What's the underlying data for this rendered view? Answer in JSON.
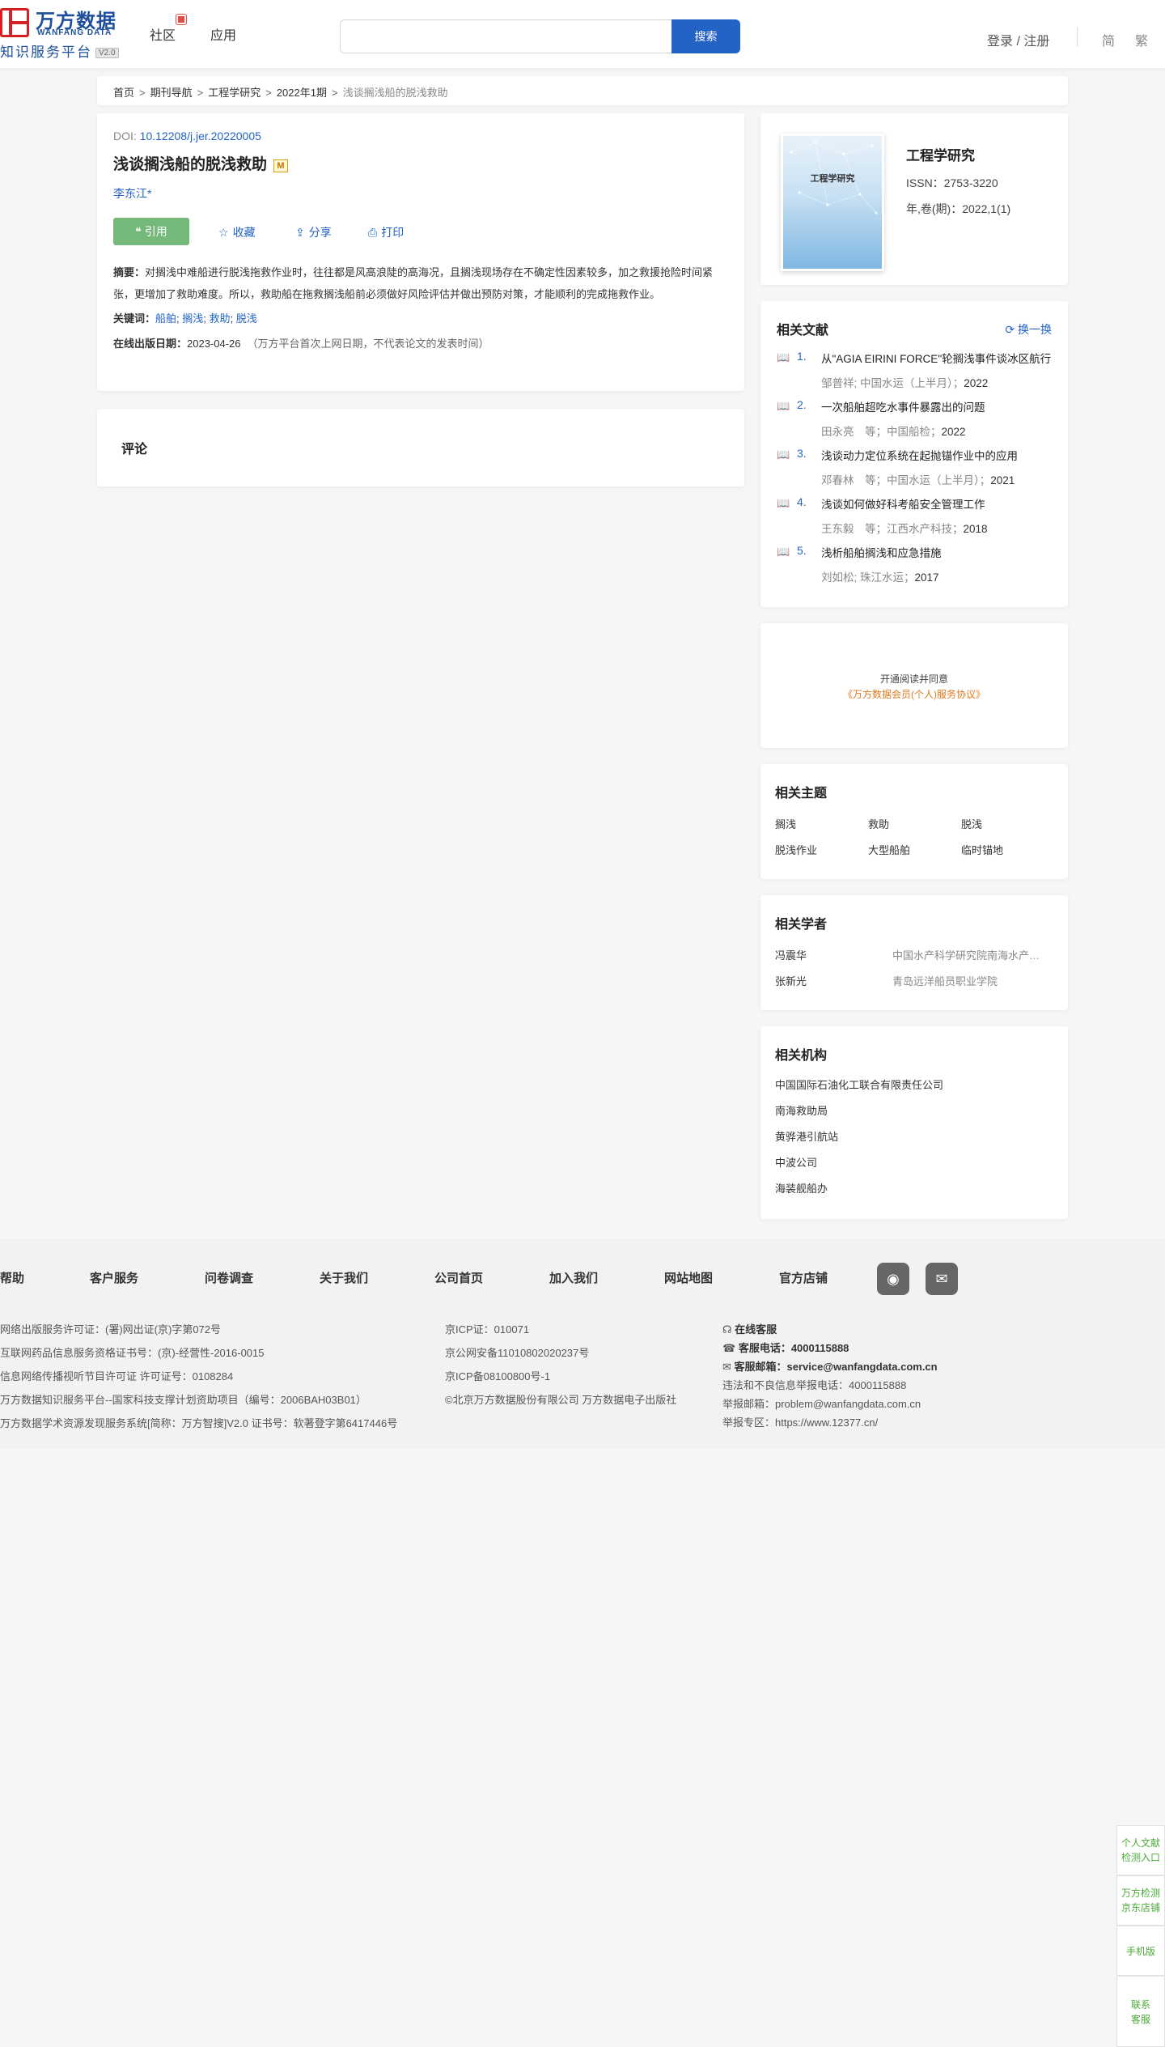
{
  "header": {
    "logo": {
      "cn": "万方数据",
      "en": "WANFANG DATA",
      "sub": "知识服务平台",
      "ver": "V2.0"
    },
    "nav": {
      "community": "社区",
      "apps": "应用"
    },
    "search": {
      "placeholder": "",
      "button": "搜索"
    },
    "login": "登录 / 注册",
    "lang_simp": "简",
    "lang_trad": "繁"
  },
  "breadcrumb": {
    "items": [
      "首页",
      "期刊导航",
      "工程学研究",
      "2022年1期"
    ],
    "current": "浅谈搁浅船的脱浅救助",
    "sep": ">"
  },
  "article": {
    "doi_label": "DOI: ",
    "doi": "10.12208/j.jer.20220005",
    "title": "浅谈搁浅船的脱浅救助",
    "badge": "M",
    "author": "李东江*",
    "actions": {
      "cite": "引用",
      "favorite": "收藏",
      "share": "分享",
      "print": "打印"
    },
    "abstract_label": "摘要：",
    "abstract": "对搁浅中难船进行脱浅拖救作业时，往往都是风高浪陡的高海况，且搁浅现场存在不确定性因素较多，加之救援抢险时间紧张，更增加了救助难度。所以，救助船在拖救搁浅船前必须做好风险评估并做出预防对策，才能顺利的完成拖救作业。",
    "keywords_label": "关键词：",
    "keywords": [
      "船舶",
      "搁浅",
      "救助",
      "脱浅"
    ],
    "pubdate_label": "在线出版日期：",
    "pubdate": "2023-04-26",
    "pubdate_note": "（万方平台首次上网日期，不代表论文的发表时间）"
  },
  "comments": {
    "title": "评论"
  },
  "journal": {
    "cover_title": "工程学研究",
    "name": "工程学研究",
    "issn": "ISSN：2753-3220",
    "volume": "年,卷(期)：2022,1(1)"
  },
  "related_literature": {
    "title": "相关文献",
    "refresh": "换一换",
    "items": [
      {
        "num": "1.",
        "title": "从\"AGIA EIRINI FORCE\"轮搁浅事件谈冰区航行",
        "authors": "邹普祥; 中国水运（上半月）；",
        "year": "2022"
      },
      {
        "num": "2.",
        "title": "一次船舶超吃水事件暴露出的问题",
        "authors": "田永亮　等；中国船检；",
        "year": "2022"
      },
      {
        "num": "3.",
        "title": "浅谈动力定位系统在起抛锚作业中的应用",
        "authors": "邓春林　等；中国水运（上半月）；",
        "year": "2021"
      },
      {
        "num": "4.",
        "title": "浅谈如何做好科考船安全管理工作",
        "authors": "王东毅　等；江西水产科技；",
        "year": "2018"
      },
      {
        "num": "5.",
        "title": "浅析船舶搁浅和应急措施",
        "authors": "刘如松; 珠江水运；",
        "year": "2017"
      }
    ]
  },
  "subscribe": {
    "line1": "开通阅读并同意",
    "line2": "《万方数据会员(个人)服务协议》"
  },
  "topics": {
    "title": "相关主题",
    "items": [
      "搁浅",
      "救助",
      "脱浅",
      "脱浅作业",
      "大型船舶",
      "临时锚地"
    ]
  },
  "scholars": {
    "title": "相关学者",
    "items": [
      {
        "name": "冯震华",
        "org": "中国水产科学研究院南海水产研究所"
      },
      {
        "name": "张新光",
        "org": "青岛远洋船员职业学院"
      }
    ]
  },
  "institutions": {
    "title": "相关机构",
    "items": [
      "中国国际石油化工联合有限责任公司",
      "南海救助局",
      "黄骅港引航站",
      "中波公司",
      "海装舰船办"
    ]
  },
  "footer": {
    "links": [
      "帮助",
      "客户服务",
      "问卷调查",
      "关于我们",
      "公司首页",
      "加入我们",
      "网站地图",
      "官方店铺"
    ],
    "col1": [
      "网络出版服务许可证：(署)网出证(京)字第072号",
      "互联网药品信息服务资格证书号：(京)-经营性-2016-0015",
      "信息网络传播视听节目许可证 许可证号：0108284",
      "万方数据知识服务平台--国家科技支撑计划资助项目（编号：2006BAH03B01）",
      "万方数据学术资源发现服务系统[简称：万方智搜]V2.0 证书号：软著登字第6417446号"
    ],
    "col2": [
      "京ICP证：010071",
      "京公网安备11010802020237号",
      "京ICP备08100800号-1",
      "©北京万方数据股份有限公司 万方数据电子出版社"
    ],
    "online_service": "在线客服",
    "phone_label": "客服电话：",
    "phone": "4000115888",
    "email_label": "客服邮箱：",
    "email": "service@wanfangdata.com.cn",
    "report_phone": "违法和不良信息举报电话：4000115888",
    "report_email": "举报邮箱：problem@wanfangdata.com.cn",
    "report_zone": "举报专区：https://www.12377.cn/"
  },
  "float": {
    "item1": [
      "个人文献",
      "检测入口"
    ],
    "item2": [
      "万方检测",
      "京东店铺"
    ],
    "item3": "手机版",
    "item4": [
      "联系",
      "客服"
    ]
  },
  "colors": {
    "brand_blue": "#2463c6",
    "logo_red": "#d71f26",
    "cite_green": "#74b87a",
    "agreement_orange": "#e07b20"
  }
}
